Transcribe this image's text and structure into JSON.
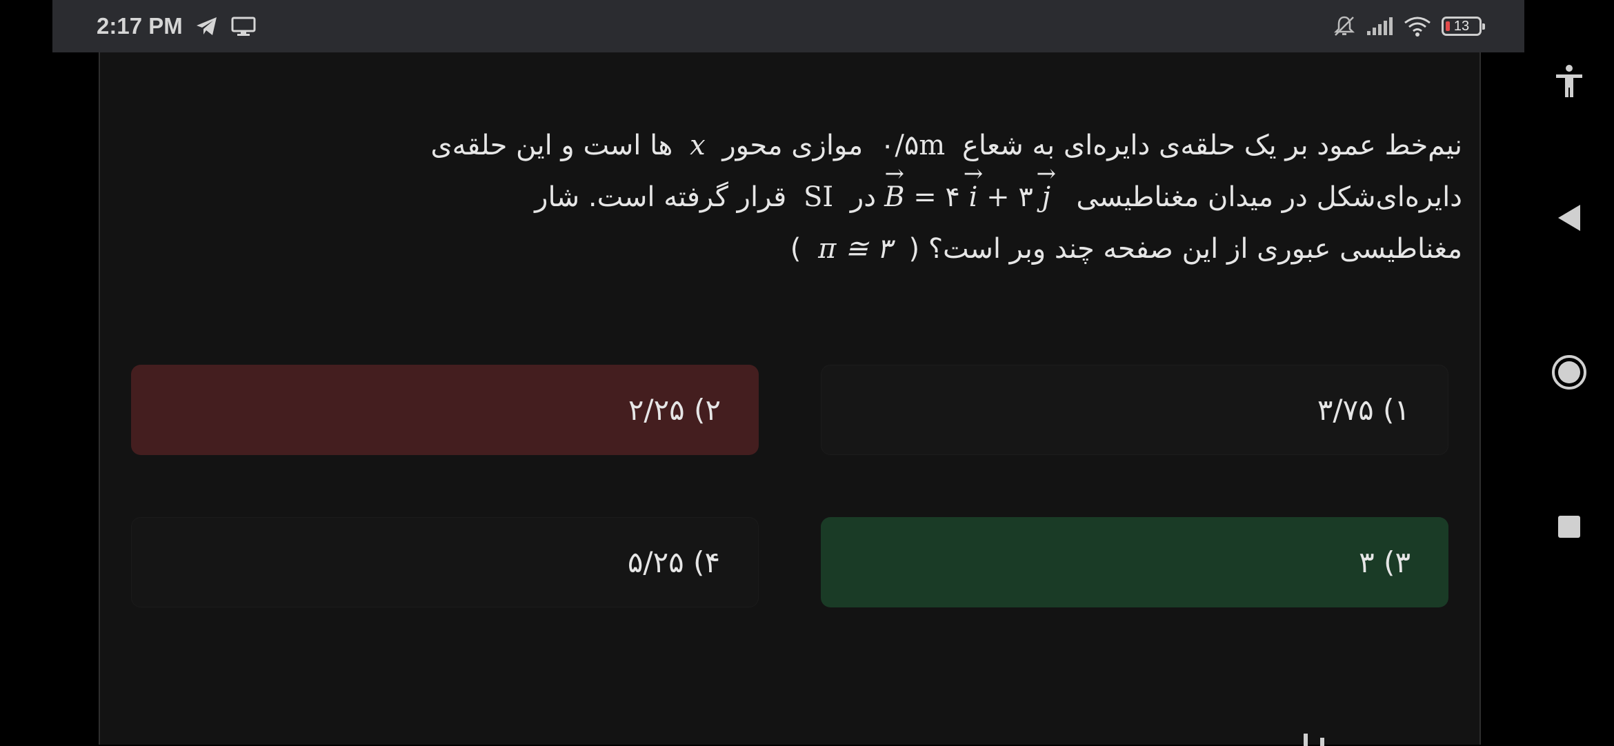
{
  "status_bar": {
    "time": "2:17 PM",
    "battery_level": "13",
    "icons": [
      "telegram-icon",
      "screen-icon",
      "mute-icon",
      "signal-icon",
      "wifi-icon",
      "battery-icon"
    ]
  },
  "question": {
    "line1_part1": "نیم‌خط عمود بر یک حلقه‌ی دایره‌ای به شعاع",
    "radius": "۰/۵m",
    "line1_part2": "موازی محور",
    "axis_var": "x",
    "line1_part3": "ها است و این حلقه‌ی",
    "line2_part1": "دایره‌ای‌شکل در میدان مغناطیسی",
    "field_B": "B",
    "field_eq": "= ۴",
    "field_i": "i",
    "field_plus": "+ ۳",
    "field_j": "j",
    "line2_part2": "در",
    "unit_system": "SI",
    "line2_part3": "قرار گرفته است. شار",
    "line3_part1": "مغناطیسی عبوری از این صفحه چند وبر است؟ (",
    "pi_approx": "π ≅ ۳",
    "line3_part2": ")"
  },
  "options": [
    {
      "label": "۱) ۳/۷۵",
      "state": "default"
    },
    {
      "label": "۲) ۲/۲۵",
      "state": "incorrect"
    },
    {
      "label": "۳) ۳",
      "state": "correct"
    },
    {
      "label": "۴) ۵/۲۵",
      "state": "default"
    }
  ],
  "colors": {
    "incorrect": "#441e1f",
    "correct": "#1a3b26",
    "background": "#131313"
  },
  "nav": {
    "icons": [
      "accessibility-icon",
      "back-icon",
      "home-icon",
      "recents-icon"
    ]
  }
}
